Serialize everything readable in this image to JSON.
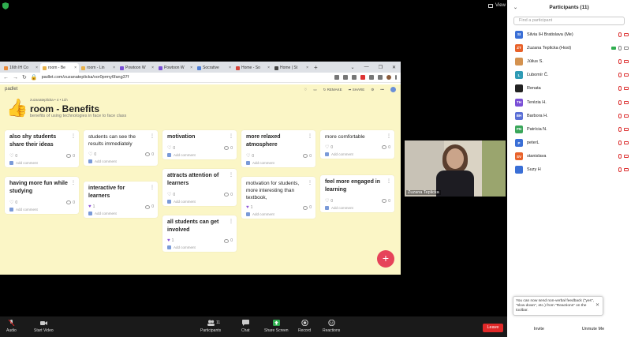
{
  "zoom": {
    "view_label": "View",
    "toolbar": {
      "audio": "Audio",
      "start_video": "Start Video",
      "participants": "Participants",
      "participants_count": "11",
      "chat": "Chat",
      "share_screen": "Share Screen",
      "record": "Record",
      "reactions": "Reactions",
      "leave": "Leave"
    }
  },
  "browser": {
    "tabs": [
      {
        "label": "16th IH Co",
        "color": "#e8893a"
      },
      {
        "label": "room - Be",
        "color": "#e8b24a"
      },
      {
        "label": "room - Lin",
        "color": "#e8b24a"
      },
      {
        "label": "Powtoon W",
        "color": "#7a4fd6"
      },
      {
        "label": "Powtoon W",
        "color": "#7a4fd6"
      },
      {
        "label": "Socrative",
        "color": "#4f7fd6"
      },
      {
        "label": "Home - So",
        "color": "#d6443a"
      },
      {
        "label": "Home | St",
        "color": "#444444"
      }
    ],
    "new_tab": "+",
    "url": "padlet.com/zuzanateplicka/xor0prmy6fang37f"
  },
  "padlet": {
    "logo": "padlet",
    "author": "zuzanateplicka • 4 • 11h",
    "title": "room - Benefits",
    "subtitle": "benefits of using technologies in face to face class",
    "remake": "REMAKE",
    "share": "SHARE",
    "add_comment": "Add comment",
    "fab": "+",
    "cards": [
      {
        "text": "also shy students share their ideas",
        "bold": true,
        "likes": "0",
        "comments": "0"
      },
      {
        "text": "having more fun while studying",
        "bold": true,
        "likes": "0",
        "comments": "0"
      },
      {
        "text": "students can see the results immediately",
        "bold": false,
        "likes": "0",
        "comments": "0"
      },
      {
        "text": "interactive for learners",
        "bold": true,
        "likes": "1",
        "comments": "0"
      },
      {
        "text": "motivation",
        "bold": true,
        "likes": "0",
        "comments": "0"
      },
      {
        "text": "attracts attention of learners",
        "bold": true,
        "likes": "0",
        "comments": "0"
      },
      {
        "text": "all students can get involved",
        "bold": true,
        "likes": "1",
        "comments": "0"
      },
      {
        "text": "more relaxed atmosphere",
        "bold": true,
        "likes": "0",
        "comments": "0"
      },
      {
        "text": "motivation for students, more interesting than textbook,",
        "bold": false,
        "likes": "1",
        "comments": "0"
      },
      {
        "text": "more comfortable",
        "bold": false,
        "likes": "0",
        "comments": "0"
      },
      {
        "text": "feel more engaged in learning",
        "bold": true,
        "likes": "0",
        "comments": "0"
      }
    ]
  },
  "video": {
    "name": "Zuzana Teplicka"
  },
  "participants_panel": {
    "title": "Participants (11)",
    "search_placeholder": "Find a participant",
    "people": [
      {
        "initials": "SI",
        "name": "Silvia IH Bratislava (Me)",
        "color": "#3a6fd6",
        "mic": "muted",
        "cam": "off"
      },
      {
        "initials": "ZT",
        "name": "Zuzana Teplicka (Host)",
        "color": "#e8622a",
        "mic": "on",
        "cam": "on"
      },
      {
        "initials": "",
        "name": "Július S.",
        "color": "#d4924f",
        "mic": "muted",
        "cam": "off"
      },
      {
        "initials": "L",
        "name": "Ľubomír Č.",
        "color": "#2f9bb5",
        "mic": "muted",
        "cam": "off"
      },
      {
        "initials": "",
        "name": "Renata",
        "color": "#222222",
        "mic": "muted",
        "cam": "off"
      },
      {
        "initials": "TH",
        "name": "Terézia H.",
        "color": "#7a4fd6",
        "mic": "muted",
        "cam": "off"
      },
      {
        "initials": "BH",
        "name": "Barbora H.",
        "color": "#5a6fd6",
        "mic": "muted",
        "cam": "off"
      },
      {
        "initials": "PN",
        "name": "Patrícia N.",
        "color": "#3aa65a",
        "mic": "muted",
        "cam": "off"
      },
      {
        "initials": "P",
        "name": "peterL",
        "color": "#3a6fd6",
        "mic": "muted",
        "cam": "off"
      },
      {
        "initials": "SV",
        "name": "stanislava",
        "color": "#e8622a",
        "mic": "muted",
        "cam": "off"
      },
      {
        "initials": "",
        "name": "Suzy H",
        "color": "#3a6fd6",
        "mic": "muted",
        "cam": "off"
      }
    ],
    "toast": "You can now send non-verbal feedback (\"yes\", \"slow down\", etc.) from \"Reactions\" on the toolbar.",
    "invite": "Invite",
    "unmute": "Unmute Me"
  }
}
